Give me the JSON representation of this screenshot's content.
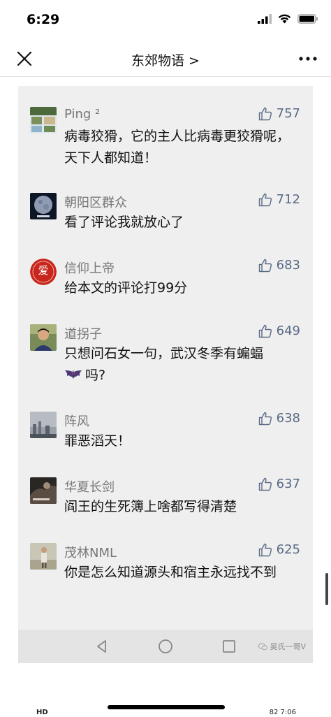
{
  "status_bar": {
    "time": "6:29"
  },
  "nav": {
    "title": "东郊物语 >"
  },
  "comments": [
    {
      "name": "Ping ²",
      "likes": "757",
      "text": "病毒狡猾，它的主人比病毒更狡猾呢，天下人都知道！",
      "avatar_color": "#6a7a5a"
    },
    {
      "name": "朝阳区群众",
      "likes": "712",
      "text": "看了评论我就放心了",
      "avatar_color": "#0d1626"
    },
    {
      "name": "信仰上帝",
      "likes": "683",
      "text": "给本文的评论打99分",
      "avatar_color": "#c8261c",
      "avatar_label": "爱"
    },
    {
      "name": "道拐子",
      "likes": "649",
      "text_before": "只想问石女一句，武汉冬季有蝙蝠",
      "emoji": "bat-emoji",
      "text_after": "吗?",
      "avatar_color": "#7a8b5a"
    },
    {
      "name": "阵风",
      "likes": "638",
      "text": "罪恶滔天！",
      "avatar_color": "#8a8f96"
    },
    {
      "name": "华夏长剑",
      "likes": "637",
      "text": "阎王的生死簿上啥都写得清楚",
      "avatar_color": "#2a2624"
    },
    {
      "name": "茂林NML",
      "likes": "625",
      "text": "你是怎么知道源头和宿主永远找不到",
      "avatar_color": "#a9a48e"
    }
  ],
  "watermark": {
    "text": "吴氏一哥V"
  },
  "bottom_status": {
    "left": "HD",
    "right": "82 7:06"
  },
  "colors": {
    "accent": "#5a6b86",
    "panel": "#efefef",
    "name": "#777777"
  }
}
